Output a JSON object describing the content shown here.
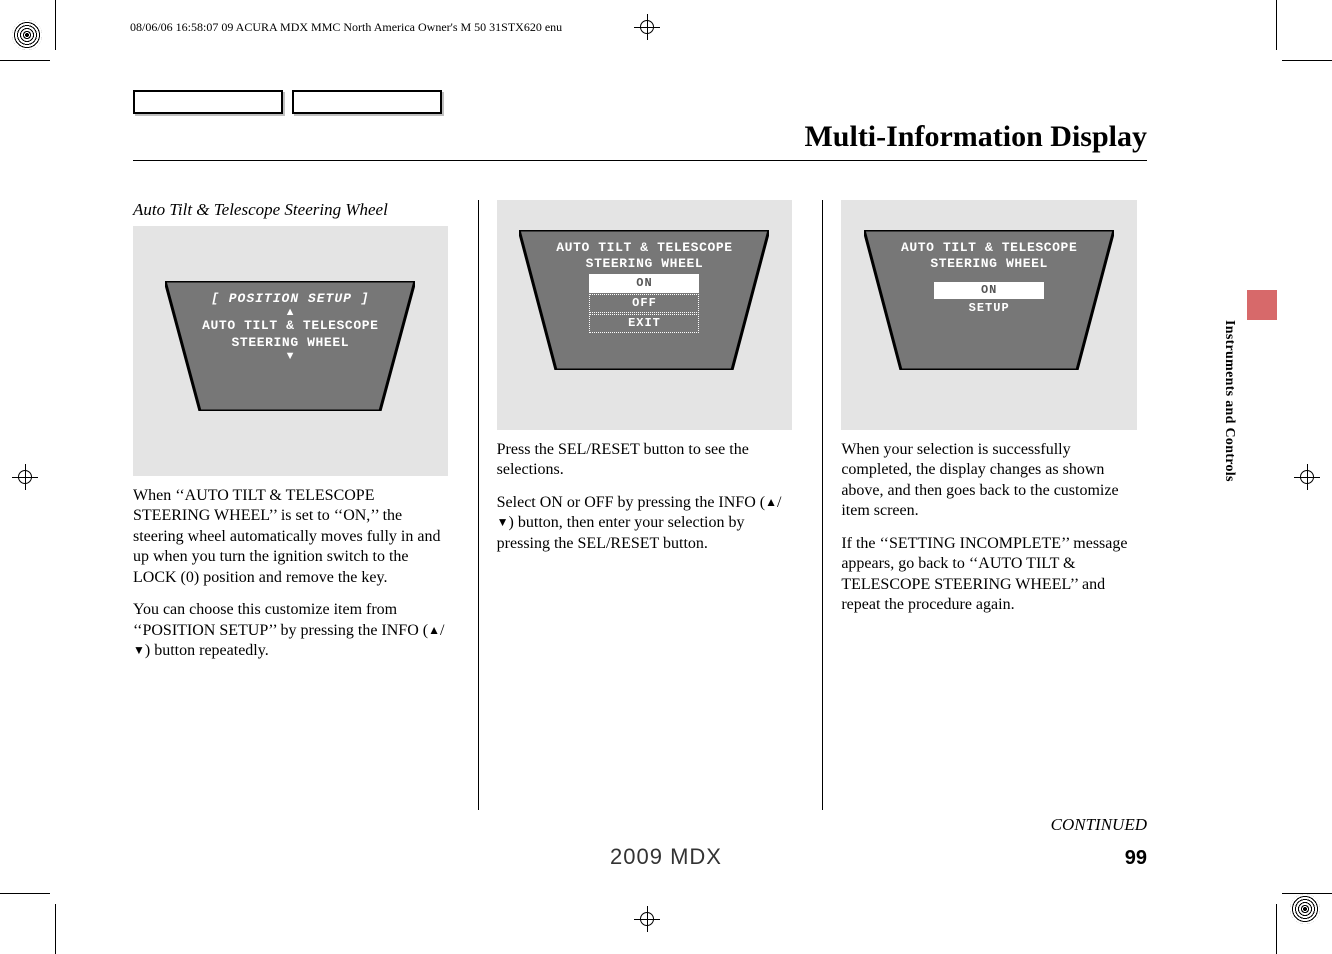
{
  "meta": {
    "header": "08/06/06 16:58:07   09 ACURA MDX MMC North America Owner's M 50 31STX620 enu"
  },
  "page": {
    "title": "Multi-Information Display",
    "section_label": "Instruments and Controls",
    "subhead": "Auto Tilt & Telescope Steering Wheel",
    "continued": "CONTINUED",
    "number": "99",
    "footer_model": "2009  MDX"
  },
  "display1": {
    "bracket": "[ POSITION SETUP ]",
    "line1": "AUTO TILT & TELESCOPE",
    "line2": "STEERING WHEEL"
  },
  "display2": {
    "line1": "AUTO TILT & TELESCOPE",
    "line2": "STEERING WHEEL",
    "opt_on": "ON",
    "opt_off": "OFF",
    "opt_exit": "EXIT"
  },
  "display3": {
    "line1": "AUTO TILT & TELESCOPE",
    "line2": "STEERING WHEEL",
    "opt_on": "ON",
    "setup": "SETUP"
  },
  "col1": {
    "p1": "When ‘‘AUTO TILT & TELESCOPE STEERING WHEEL’’ is set to ‘‘ON,’’ the steering wheel automatically moves fully in and up when you turn the ignition switch to the LOCK (0) position and remove the key.",
    "p2a": "You can choose this customize item from ‘‘POSITION SETUP’’ by pressing the INFO (",
    "p2b": ") button repeatedly."
  },
  "col2": {
    "p1": "Press the SEL/RESET button to see the selections.",
    "p2a": "Select ON or OFF by pressing the INFO (",
    "p2b": ") button, then enter your selection by pressing the SEL/RESET button."
  },
  "col3": {
    "p1": "When your selection is successfully completed, the display changes as shown above, and then goes back to the customize item screen.",
    "p2": "If the ‘‘SETTING INCOMPLETE’’ message appears, go back to ‘‘AUTO TILT & TELESCOPE STEERING WHEEL’’ and repeat the procedure again."
  }
}
